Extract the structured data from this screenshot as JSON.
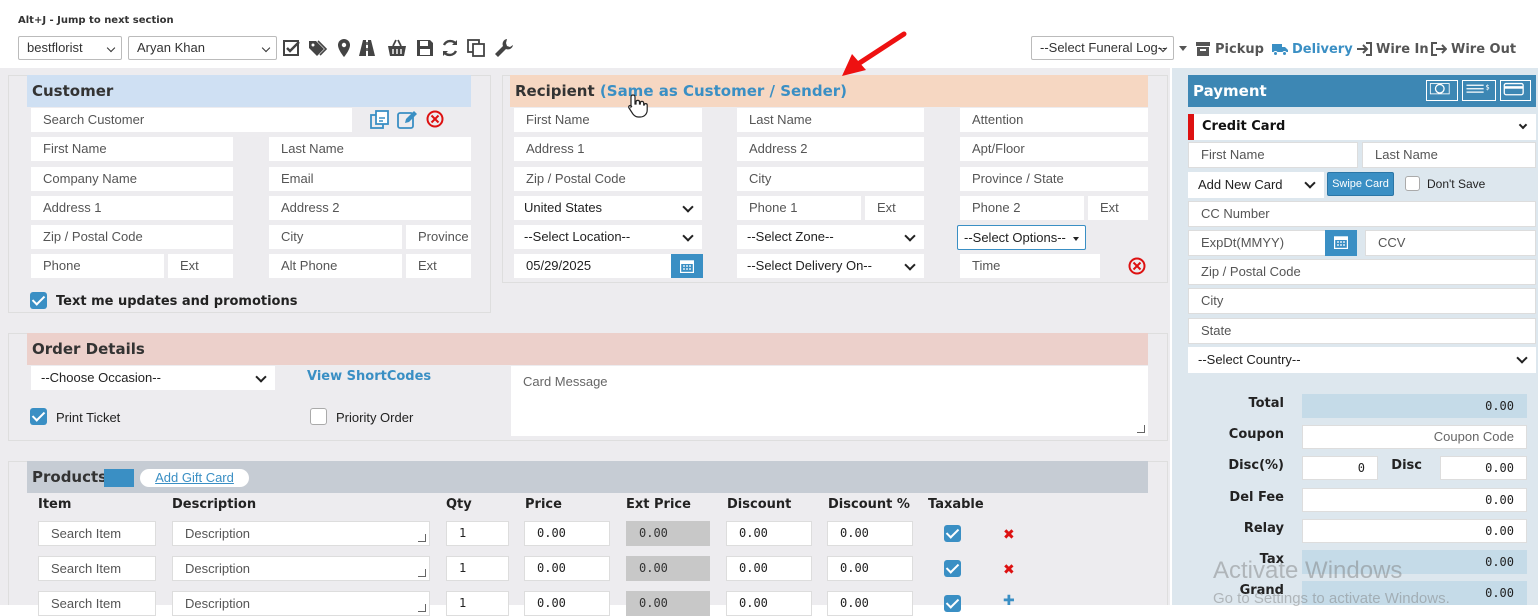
{
  "toolbar": {
    "hint": "Alt+J - Jump to next section",
    "store_select": "bestflorist",
    "user_select": "Aryan Khan",
    "funeral_log_select": "--Select Funeral Log--",
    "pickup_label": "Pickup",
    "delivery_label": "Delivery",
    "wire_in_label": "Wire In",
    "wire_out_label": "Wire Out"
  },
  "customer": {
    "title": "Customer",
    "search_placeholder": "Search Customer",
    "first_name": "First Name",
    "last_name": "Last Name",
    "company_name": "Company Name",
    "email": "Email",
    "address1": "Address 1",
    "address2": "Address 2",
    "zip": "Zip / Postal Code",
    "city": "City",
    "province": "Province",
    "phone": "Phone",
    "ext": "Ext",
    "alt_phone": "Alt Phone",
    "alt_ext": "Ext",
    "text_me_label": "Text me updates and promotions",
    "text_me_checked": true
  },
  "recipient": {
    "title": "Recipient",
    "same_as_link": "(Same as Customer / Sender)",
    "first_name": "First Name",
    "last_name": "Last Name",
    "attention": "Attention",
    "address1": "Address 1",
    "address2": "Address 2",
    "apt": "Apt/Floor",
    "zip": "Zip / Postal Code",
    "city": "City",
    "province_state": "Province / State",
    "country": "United States",
    "phone1": "Phone 1",
    "phone1_ext": "Ext",
    "phone2": "Phone 2",
    "phone2_ext": "Ext",
    "location": "--Select Location--",
    "zone": "--Select Zone--",
    "options": "--Select Options--",
    "date": "05/29/2025",
    "delivery_on": "--Select Delivery On--",
    "time": "Time"
  },
  "order_details": {
    "title": "Order Details",
    "occasion": "--Choose Occasion--",
    "view_shortcodes": "View ShortCodes",
    "card_message": "Card Message",
    "print_ticket_label": "Print Ticket",
    "print_ticket_checked": true,
    "priority_order_label": "Priority Order",
    "priority_order_checked": false
  },
  "products": {
    "title": "Products",
    "add_gift_card": "Add Gift Card",
    "columns": [
      "Item",
      "Description",
      "Qty",
      "Price",
      "Ext Price",
      "Discount",
      "Discount %",
      "Taxable"
    ],
    "rows": [
      {
        "item": "Search Item",
        "description": "Description",
        "qty": "1",
        "price": "0.00",
        "ext_price": "0.00",
        "discount": "0.00",
        "discount_pct": "0.00",
        "taxable": true,
        "action": "✖"
      },
      {
        "item": "Search Item",
        "description": "Description",
        "qty": "1",
        "price": "0.00",
        "ext_price": "0.00",
        "discount": "0.00",
        "discount_pct": "0.00",
        "taxable": true,
        "action": "✖"
      },
      {
        "item": "Search Item",
        "description": "Description",
        "qty": "1",
        "price": "0.00",
        "ext_price": "0.00",
        "discount": "0.00",
        "discount_pct": "0.00",
        "taxable": true,
        "action": "✚"
      }
    ]
  },
  "payment": {
    "title": "Payment",
    "method": "Credit Card",
    "first_name": "First Name",
    "last_name": "Last Name",
    "card_select": "Add New Card",
    "swipe_card": "Swipe Card",
    "dont_save": "Don't Save",
    "cc_number": "CC Number",
    "exp_date": "ExpDt(MMYY)",
    "ccv": "CCV",
    "zip": "Zip / Postal Code",
    "city": "City",
    "state": "State",
    "country": "--Select Country--",
    "total_label": "Total",
    "total": "0.00",
    "coupon_label": "Coupon",
    "coupon_placeholder": "Coupon Code",
    "disc_pct_label": "Disc(%)",
    "disc_pct": "0",
    "disc_label": "Disc",
    "disc": "0.00",
    "del_fee_label": "Del Fee",
    "del_fee": "0.00",
    "relay_label": "Relay",
    "relay": "0.00",
    "tax_label": "Tax",
    "tax": "0.00",
    "grand_label": "Grand",
    "grand": "0.00"
  },
  "watermark": {
    "line1": "Activate Windows",
    "line2": "Go to Settings to activate Windows."
  },
  "colors": {
    "accent": "#3a8fc4",
    "customer_head": "#cfe0f3",
    "recipient_head": "#f6d7c2",
    "order_head": "#ecd0cb",
    "products_head": "#c6ccd4",
    "payment_head": "#3d87b4",
    "danger": "#d11111"
  }
}
